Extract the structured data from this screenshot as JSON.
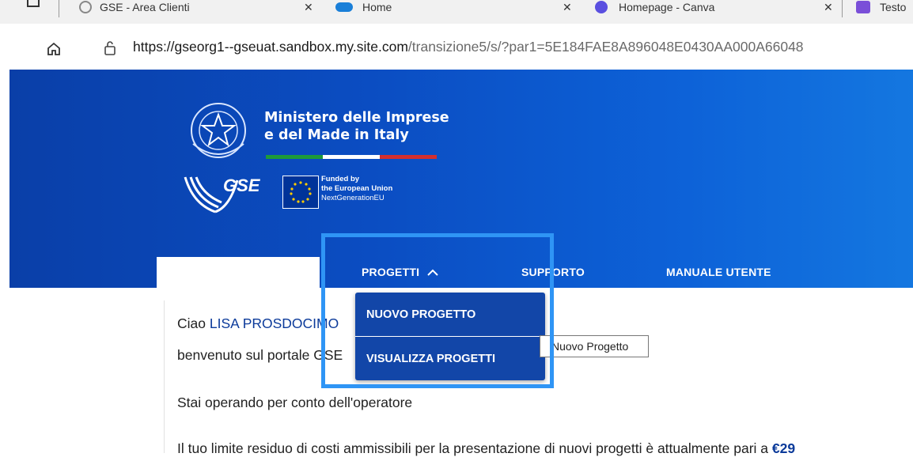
{
  "browser": {
    "tabs": [
      {
        "label": "GSE - Area Clienti"
      },
      {
        "label": "Home"
      },
      {
        "label": "Homepage - Canva"
      },
      {
        "label": "Testo"
      }
    ],
    "url_host": "https://gseorg1--gseuat.sandbox.my.site.com",
    "url_path": "/transizione5/s/?par1=5E184FAE8A896048E0430AA000A66048"
  },
  "header": {
    "ministry_line1": "Ministero delle Imprese",
    "ministry_line2": "e del Made in Italy",
    "gse_logo": "GSE",
    "eu_line1": "Funded by",
    "eu_line2": "the European Union",
    "eu_line3": "NextGenerationEU",
    "flag_colors": [
      "#1d9a3a",
      "#ffffff",
      "#d32f2f"
    ]
  },
  "nav": {
    "progetti": "PROGETTI",
    "supporto": "SUPPORTO",
    "manuale": "MANUALE UTENTE",
    "dropdown": {
      "nuovo": "NUOVO PROGETTO",
      "visualizza": "VISUALIZZA PROGETTI"
    },
    "tooltip": "Nuovo Progetto"
  },
  "main": {
    "greeting_prefix": "Ciao ",
    "user_name": "LISA PROSDOCIMO",
    "welcome": "benvenuto sul portale GSE",
    "operator": "Stai operando per conto dell'operatore",
    "limit_text": "Il tuo limite residuo di costi ammissibili per la presentazione di nuovi progetti è attualmente pari a ",
    "limit_value": "€29"
  },
  "colors": {
    "banner": "#0b4dc2",
    "highlight": "#2f95f5",
    "dropdown": "#1246a8"
  }
}
